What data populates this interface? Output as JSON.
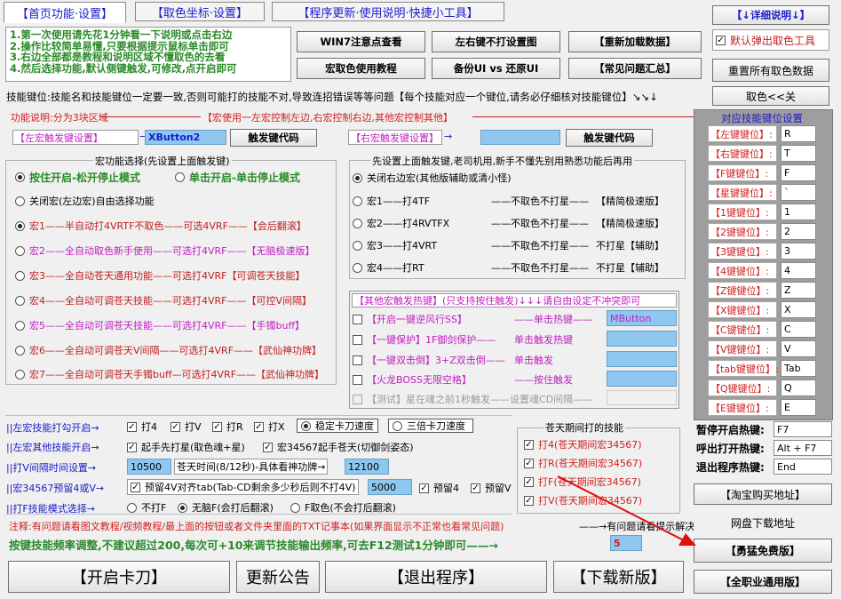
{
  "tabs": [
    "【首页功能·设置】",
    "【取色坐标·设置】",
    "【程序更新·使用说明·快捷小工具】"
  ],
  "top_right": {
    "detail_button": "【↓详细说明↓】",
    "default_popup_label": "默认弹出取色工具",
    "reset_button": "重置所有取色数据",
    "pick_color_button": "取色<<关"
  },
  "instructions": [
    "1.第一次使用请先花1分钟看一下说明或点击右边",
    "2.操作比较简单易懂,只要根据提示鼠标单击即可",
    "3.右边全部都是教程和说明区域不懂取色的去看",
    "4.然后选择功能,默认侧键触发,可修改,点开启即可"
  ],
  "top_buttons": {
    "win7": "WIN7注意点查看",
    "lr_key": "左右键不打设置图",
    "reload": "【重新加载数据】",
    "macro_tutorial": "宏取色使用教程",
    "backup": "备份UI vs 还原UI",
    "faq": "【常见问题汇总】"
  },
  "skill_note": "技能键位:技能名和技能键位一定要一致,否则可能打的技能不对,导致连招错误等等问题【每个技能对应一个键位,请务必仔细核对技能键位】↘↘↓",
  "func_desc": "功能说明:分为3块区域",
  "macro_desc": "【宏使用一左宏控制左边,右宏控制右边,其他宏控制其他】",
  "left_trigger": {
    "label": "【左宏触发键设置】",
    "value": "XButton2",
    "code_button": "触发键代码"
  },
  "right_trigger": {
    "label": "【右宏触发键设置】",
    "value": "",
    "code_button": "触发键代码"
  },
  "macro_group": {
    "title": "宏功能选择(先设置上面触发键)",
    "mode1": "按住开启-松开停止模式",
    "mode2": "单击开启-单击停止模式",
    "options": [
      {
        "text": "关闭宏(左边宏)自由选择功能",
        "color": "#000000"
      },
      {
        "text": "宏1——半自动打4VRTF不取色——可选4VRF——【会后翻滚】",
        "color": "#c02020"
      },
      {
        "text": "宏2——全自动取色新手使用——可选打4VRF——【无脑极速版】",
        "color": "#c020c0"
      },
      {
        "text": "宏3——全自动苍天通用功能——可选打4VRF【可调苍天技能】",
        "color": "#c02020"
      },
      {
        "text": "宏4——全自动可调苍天技能——可选打4VRF——【可控V间隔】",
        "color": "#c02020"
      },
      {
        "text": "宏5——全自动可调苍天技能——可选打4VRF——【手镯buff】",
        "color": "#c020c0"
      },
      {
        "text": "宏6——全自动可调苍天V间隔——可选打4VRF——【武仙神功牌】",
        "color": "#c02020"
      },
      {
        "text": "宏7——全自动可调苍天手镯buff—可选打4VRF——【武仙神功牌】",
        "color": "#c02020"
      }
    ]
  },
  "right_group": {
    "title": "先设置上面触发键,老司机用,新手不懂先别用熟悉功能后再用",
    "options": [
      {
        "text": "关闭右边宏(其他版辅助或清小怪)"
      },
      {
        "a": "宏1——打4TF",
        "b": "——不取色不打星——",
        "c": "【精简极速版】"
      },
      {
        "a": "宏2——打4RVTFX",
        "b": "——不取色不打星——",
        "c": "【精简极速版】"
      },
      {
        "a": "宏3——打4VRT",
        "b": "——不取色不打星——",
        "c": "不打星【辅助】"
      },
      {
        "a": "宏4——打RT",
        "b": "——不取色不打星——",
        "c": "不打星【辅助】"
      }
    ]
  },
  "other_group": {
    "title": "【其他宏触发热键】(只支持按住触发)↓↓↓请自由设定不冲突即可",
    "rows": [
      {
        "a": "【开启一键逆风行SS】",
        "b": "——单击热键——",
        "value": "MButton"
      },
      {
        "a": "【一键保护】1F御剑保护——",
        "b": "单击触发热键",
        "value": ""
      },
      {
        "a": "【一键双击倒】3+Z双击倒——",
        "b": "单击触发",
        "value": ""
      },
      {
        "a": "【火龙BOSS无限空格】",
        "b": "——按住触发",
        "value": ""
      },
      {
        "a": "【测试】星在魂之前1秒触发——设置魂CD间隔——",
        "b": "",
        "value": ""
      }
    ]
  },
  "left_settings": {
    "skill_on_label": "||左宏技能打勾开启→",
    "skills": [
      "打4",
      "打V",
      "打R",
      "打X"
    ],
    "stable": "稳定卡刀速度",
    "triple": "三倍卡刀速度",
    "other_label": "||左宏其他技能开启→",
    "star_first": "起手先打星(取色魂+星)",
    "macro345": "宏34567起手苍天(切御剑姿态)",
    "interval_label": "||打V间隔时间设置→",
    "interval_value": "10500",
    "cangtian_text": "苍天时间(8/12秒)-具体看神功牌→",
    "cangtian_value": "12100",
    "reserve_label": "||宏34567预留4或V→",
    "reserve_text": "预留4V对齐tab(Tab-CD剩余多少秒后则不打4V)",
    "reserve_value": "5000",
    "reserve4": "预留4",
    "reserveV": "预留V",
    "f_label": "||打F技能模式选择→",
    "f_opt1": "不打F",
    "f_opt2": "无脑F(会打后翻滚)",
    "f_opt3": "F取色(不会打后翻滚)"
  },
  "cangtian_group": {
    "title": "苍天期间打的技能",
    "items": [
      "打4(苍天期间宏34567)",
      "打R(苍天期间宏34567)",
      "打F(苍天期间宏34567)",
      "打V(苍天期间宏34567)"
    ]
  },
  "notes": {
    "note1": "注释:有问题请看图文教程/视频教程/最上面的按钮或者文件夹里面的TXT记事本(如果界面显示不正常也看常见问题)",
    "note1_right": "——→有问题请看提示解决",
    "freq": "按键技能频率调整,不建议超过200,每次可+10来调节技能输出频率,可去F12测试1分钟即可——→",
    "freq_value": "5"
  },
  "bottom_buttons": {
    "start": "【开启卡刀】",
    "update": "更新公告",
    "exit": "【退出程序】",
    "download": "【下载新版】"
  },
  "keymap": {
    "title": "对应技能键位设置",
    "rows": [
      {
        "label": "【左键键位】:",
        "value": "R"
      },
      {
        "label": "【右键键位】:",
        "value": "T"
      },
      {
        "label": "【F键键位】:",
        "value": "F"
      },
      {
        "label": "【星键键位】:",
        "value": "`"
      },
      {
        "label": "【1键键位】:",
        "value": "1"
      },
      {
        "label": "【2键键位】:",
        "value": "2"
      },
      {
        "label": "【3键键位】:",
        "value": "3"
      },
      {
        "label": "【4键键位】:",
        "value": "4"
      },
      {
        "label": "【Z键键位】:",
        "value": "Z"
      },
      {
        "label": "【X键键位】:",
        "value": "X"
      },
      {
        "label": "【C键键位】:",
        "value": "C"
      },
      {
        "label": "【V键键位】:",
        "value": "V"
      },
      {
        "label": "【tab键键位】:",
        "value": "Tab"
      },
      {
        "label": "【Q键键位】:",
        "value": "Q"
      },
      {
        "label": "【E键键位】:",
        "value": "E"
      }
    ]
  },
  "hotkeys": [
    {
      "label": "暂停开启热键:",
      "value": "F7"
    },
    {
      "label": "呼出打开热键:",
      "value": "Alt + F7"
    },
    {
      "label": "退出程序热键:",
      "value": "End"
    }
  ],
  "side_buttons": {
    "taobao": "【淘宝购买地址】",
    "netdisk": "网盘下载地址",
    "free": "【勇猛免费版】",
    "all_class": "【全职业通用版】"
  }
}
